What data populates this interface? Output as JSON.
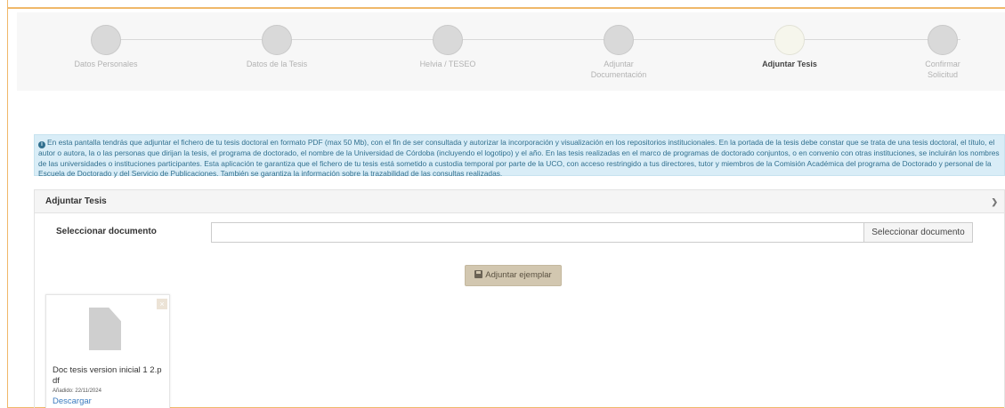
{
  "wizard": {
    "steps": [
      {
        "label": "Datos Personales",
        "active": false
      },
      {
        "label": "Datos de la Tesis",
        "active": false
      },
      {
        "label": "Helvia / TESEO",
        "active": false
      },
      {
        "label": "Adjuntar\nDocumentación",
        "active": false
      },
      {
        "label": "Adjuntar Tesis",
        "active": true
      },
      {
        "label": "Confirmar\nSolicitud",
        "active": false
      }
    ]
  },
  "info": {
    "icon": "info-circle-icon",
    "text": "En esta pantalla tendrás que adjuntar el fichero de tu tesis doctoral en formato PDF (max 50 Mb), con el fin de ser consultada y autorizar la incorporación y visualización en los repositorios institucionales. En la portada de la tesis debe constar que se trata de una tesis doctoral, el título, el autor o autora, la o las personas que dirijan la tesis, el programa de doctorado, el nombre de la Universidad de Córdoba (incluyendo el logotipo) y el año. En las tesis realizadas en el marco de programas de doctorado conjuntos, o en convenio con otras instituciones, se incluirán los nombres de las universidades o instituciones participantes. Esta aplicación te garantiza que el fichero de tu tesis está sometido a custodia temporal por parte de la UCO, con acceso restringido a tus directores, tutor y miembros de la Comisión Académica del programa de Doctorado y personal de la Escuela de Doctorado y del Servicio de Publicaciones. También se garantiza la información sobre la trazabilidad de las consultas realizadas."
  },
  "panel": {
    "title": "Adjuntar Tesis",
    "select_label": "Seleccionar documento",
    "select_input_value": "",
    "select_button": "Seleccionar documento",
    "attach_button": "Adjuntar ejemplar"
  },
  "file": {
    "name": "Doc tesis version inicial 1 2.pdf",
    "date": "Añadido: 22/11/2024",
    "download": "Descargar",
    "remove": "×"
  },
  "colors": {
    "accent_border": "#f0b86a",
    "info_bg": "#d9edf7",
    "info_text": "#31708f",
    "link": "#3b7bbf"
  }
}
